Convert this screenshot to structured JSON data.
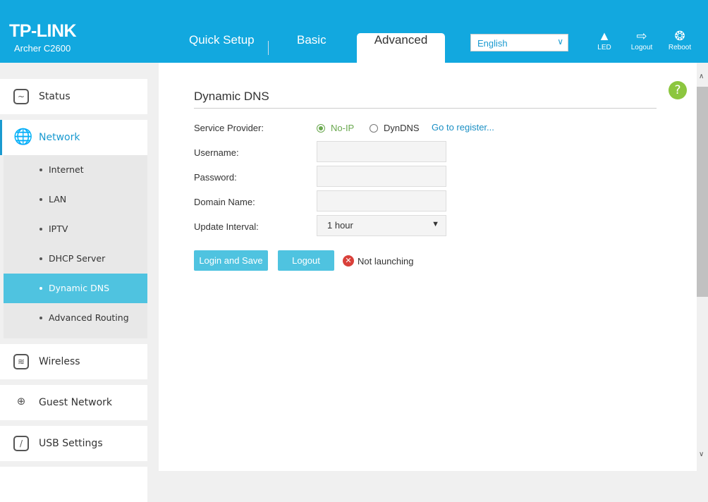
{
  "header": {
    "brand": "TP-LINK",
    "model": "Archer C2600",
    "tabs": [
      {
        "label": "Quick Setup"
      },
      {
        "label": "Basic"
      },
      {
        "label": "Advanced",
        "active": true
      }
    ],
    "language": "English",
    "actions": [
      {
        "label": "LED",
        "icon": "led-bulb-icon"
      },
      {
        "label": "Logout",
        "icon": "logout-icon"
      },
      {
        "label": "Reboot",
        "icon": "reboot-icon"
      }
    ]
  },
  "sidebar": {
    "items": [
      {
        "label": "Status",
        "icon": "status-icon"
      },
      {
        "label": "Network",
        "icon": "globe-icon",
        "expanded": true
      },
      {
        "label": "Wireless",
        "icon": "wireless-icon"
      },
      {
        "label": "Guest Network",
        "icon": "guest-network-icon"
      },
      {
        "label": "USB Settings",
        "icon": "usb-icon"
      }
    ],
    "network_sub": [
      {
        "label": "Internet"
      },
      {
        "label": "LAN"
      },
      {
        "label": "IPTV"
      },
      {
        "label": "DHCP Server"
      },
      {
        "label": "Dynamic DNS",
        "selected": true
      },
      {
        "label": "Advanced Routing"
      }
    ]
  },
  "main": {
    "title": "Dynamic DNS",
    "service_provider": {
      "label": "Service Provider:",
      "options": [
        "No-IP",
        "DynDNS"
      ],
      "selected": "No-IP",
      "register_link": "Go to register..."
    },
    "username": {
      "label": "Username:",
      "value": ""
    },
    "password": {
      "label": "Password:",
      "value": ""
    },
    "domain": {
      "label": "Domain Name:",
      "value": ""
    },
    "interval": {
      "label": "Update Interval:",
      "value": "1 hour"
    },
    "login_save": "Login and Save",
    "logout": "Logout",
    "status": "Not launching"
  },
  "colors": {
    "header": "#12a8df",
    "accent": "#4fc3e0",
    "selected_radio": "#6aa84f",
    "error": "#d9403a",
    "help": "#8cc63f"
  }
}
